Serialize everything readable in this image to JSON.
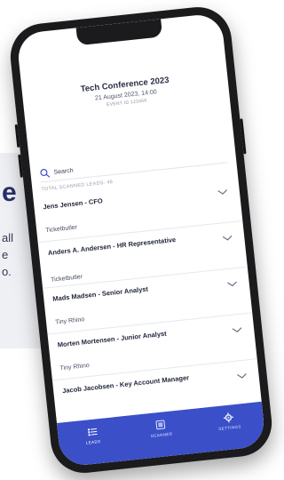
{
  "background": {
    "heading_fragment": "e",
    "text_fragments": [
      "all",
      "e",
      "o."
    ]
  },
  "event": {
    "title": "Tech Conference 2023",
    "date": "21 August 2023, 14:00",
    "id_label": "EVENT ID 123456"
  },
  "search": {
    "placeholder": "Search"
  },
  "leads_count_label": "TOTAL SCANNED LEADS: 48",
  "leads": [
    {
      "name": "Jens Jensen - CFO",
      "company": "Ticketbutler"
    },
    {
      "name": "Anders A. Andersen - HR Representative",
      "company": "Ticketbutler"
    },
    {
      "name": "Mads Madsen - Senior Analyst",
      "company": "Tiny Rhino"
    },
    {
      "name": "Morten Mortensen - Junior Analyst",
      "company": "Tiny Rhino"
    },
    {
      "name": "Jacob Jacobsen - Key Account Manager",
      "company": ""
    }
  ],
  "tabs": [
    {
      "label": "LEADS",
      "icon": "list-icon"
    },
    {
      "label": "SCANNER",
      "icon": "scanner-icon"
    },
    {
      "label": "SETTINGS",
      "icon": "gear-icon"
    }
  ],
  "colors": {
    "accent": "#3b4fc8",
    "frame": "#1b1b1d",
    "text": "#23283d"
  }
}
